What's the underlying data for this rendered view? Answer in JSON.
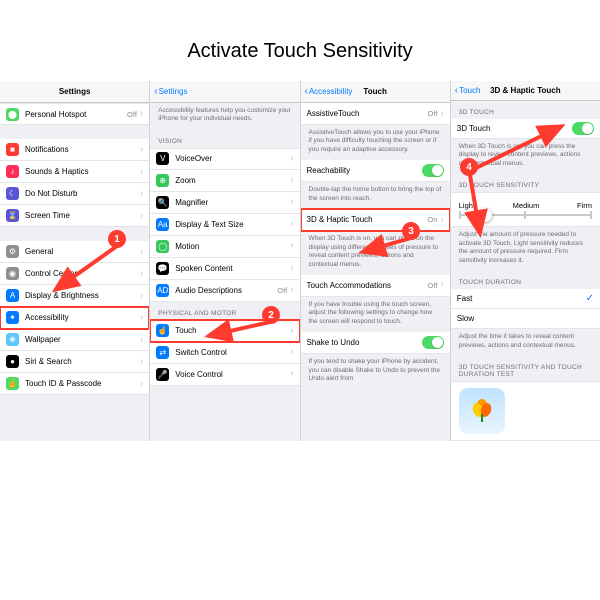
{
  "page_title": "Activate Touch Sensitivity",
  "col1": {
    "title": "Settings",
    "rows": [
      {
        "icon": "#4cd964",
        "glyph": "⬤",
        "label": "Personal Hotspot",
        "val": "Off"
      },
      {
        "icon": "#ff3b30",
        "glyph": "■",
        "label": "Notifications"
      },
      {
        "icon": "#ff2d55",
        "glyph": "♪",
        "label": "Sounds & Haptics"
      },
      {
        "icon": "#5856d6",
        "glyph": "☾",
        "label": "Do Not Disturb"
      },
      {
        "icon": "#5856d6",
        "glyph": "⌛",
        "label": "Screen Time"
      },
      {
        "icon": "#8e8e93",
        "glyph": "⚙",
        "label": "General"
      },
      {
        "icon": "#8e8e93",
        "glyph": "◉",
        "label": "Control Center"
      },
      {
        "icon": "#007aff",
        "glyph": "A",
        "label": "Display & Brightness"
      },
      {
        "icon": "#007aff",
        "glyph": "✦",
        "label": "Accessibility",
        "highlight": true
      },
      {
        "icon": "#5ac8fa",
        "glyph": "❀",
        "label": "Wallpaper"
      },
      {
        "icon": "#000000",
        "glyph": "●",
        "label": "Siri & Search"
      },
      {
        "icon": "#4cd964",
        "glyph": "☝",
        "label": "Touch ID & Passcode"
      }
    ]
  },
  "col2": {
    "back": "Settings",
    "desc": "Accessibility features help you customize your iPhone for your individual needs.",
    "group_vision": "VISION",
    "vision_rows": [
      {
        "icon": "#000",
        "glyph": "V",
        "label": "VoiceOver"
      },
      {
        "icon": "#34c759",
        "glyph": "⊕",
        "label": "Zoom"
      },
      {
        "icon": "#000",
        "glyph": "🔍",
        "label": "Magnifier"
      },
      {
        "icon": "#007aff",
        "glyph": "Aa",
        "label": "Display & Text Size"
      },
      {
        "icon": "#34c759",
        "glyph": "◯",
        "label": "Motion"
      },
      {
        "icon": "#000",
        "glyph": "💬",
        "label": "Spoken Content"
      },
      {
        "icon": "#007aff",
        "glyph": "AD",
        "label": "Audio Descriptions",
        "val": "Off"
      }
    ],
    "group_motor": "PHYSICAL AND MOTOR",
    "motor_rows": [
      {
        "icon": "#007aff",
        "glyph": "☝",
        "label": "Touch",
        "highlight": true
      },
      {
        "icon": "#007aff",
        "glyph": "⇄",
        "label": "Switch Control"
      },
      {
        "icon": "#000",
        "glyph": "🎤",
        "label": "Voice Control"
      }
    ]
  },
  "col3": {
    "back": "Accessibility",
    "title": "Touch",
    "at_label": "AssistiveTouch",
    "at_val": "Off",
    "at_desc": "AssistiveTouch allows you to use your iPhone if you have difficulty touching the screen or if you require an adaptive accessory.",
    "reach_label": "Reachability",
    "reach_desc": "Double-tap the home button to bring the top of the screen into reach.",
    "haptic_label": "3D & Haptic Touch",
    "haptic_val": "On",
    "haptic_desc": "When 3D Touch is on, you can press on the display using different degrees of pressure to reveal content previews, actions and contextual menus.",
    "accom_label": "Touch Accommodations",
    "accom_val": "Off",
    "accom_desc": "If you have trouble using the touch screen, adjust the following settings to change how the screen will respond to touch.",
    "shake_label": "Shake to Undo",
    "shake_desc": "If you tend to shake your iPhone by accident, you can disable Shake to Undo to prevent the Undo alert from"
  },
  "col4": {
    "back": "Touch",
    "title": "3D & Haptic Touch",
    "group_3d": "3D TOUCH",
    "toggle_label": "3D Touch",
    "toggle_desc": "When 3D Touch is on, you can press the display to reveal content previews, actions and contextual menus.",
    "group_sens": "3D TOUCH SENSITIVITY",
    "sens_labels": [
      "Light",
      "Medium",
      "Firm"
    ],
    "sens_desc": "Adjust the amount of pressure needed to activate 3D Touch. Light sensitivity reduces the amount of pressure required. Firm sensitivity increases it.",
    "group_dur": "TOUCH DURATION",
    "dur_fast": "Fast",
    "dur_slow": "Slow",
    "dur_desc": "Adjust the time it takes to reveal content previews, actions and contextual menus.",
    "group_test": "3D TOUCH SENSITIVITY AND TOUCH DURATION TEST"
  },
  "annotations": {
    "1": "1",
    "2": "2",
    "3": "3",
    "4": "4"
  }
}
